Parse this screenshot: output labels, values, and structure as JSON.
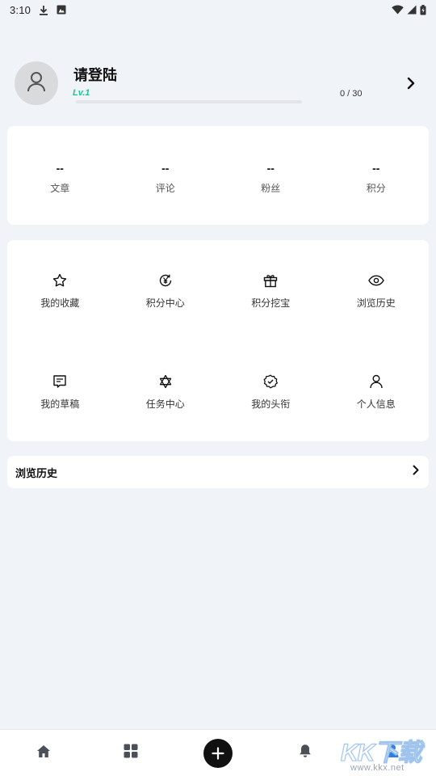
{
  "status_bar": {
    "time": "3:10",
    "icons_left": [
      "download-icon",
      "image-icon"
    ],
    "icons_right": [
      "wifi-icon",
      "signal-icon",
      "battery-icon"
    ]
  },
  "profile": {
    "title": "请登陆",
    "level": "Lv.1",
    "progress_text": "0 / 30",
    "progress_fraction": 0.0
  },
  "stats": [
    {
      "value": "--",
      "label": "文章"
    },
    {
      "value": "--",
      "label": "评论"
    },
    {
      "value": "--",
      "label": "粉丝"
    },
    {
      "value": "--",
      "label": "积分"
    }
  ],
  "menu": [
    {
      "label": "我的收藏",
      "icon": "star-icon"
    },
    {
      "label": "积分中心",
      "icon": "yen-refresh-icon"
    },
    {
      "label": "积分挖宝",
      "icon": "gift-icon"
    },
    {
      "label": "浏览历史",
      "icon": "eye-icon"
    },
    {
      "label": "我的草稿",
      "icon": "draft-icon"
    },
    {
      "label": "任务中心",
      "icon": "star-of-david-icon"
    },
    {
      "label": "我的头衔",
      "icon": "badge-check-icon"
    },
    {
      "label": "个人信息",
      "icon": "person-icon"
    }
  ],
  "history_row": {
    "label": "浏览历史"
  },
  "bottom_nav": {
    "items": [
      "home-icon",
      "apps-icon",
      "add-icon",
      "bell-icon",
      "profile-icon"
    ],
    "active": "profile-icon",
    "accent": "#2f7de1"
  },
  "watermark": {
    "logo": "KK下载",
    "url": "www.kkx.net"
  },
  "colors": {
    "background": "#f0f3f8",
    "level_green": "#1ec39a",
    "card": "#ffffff",
    "nav_active": "#2f7de1"
  }
}
